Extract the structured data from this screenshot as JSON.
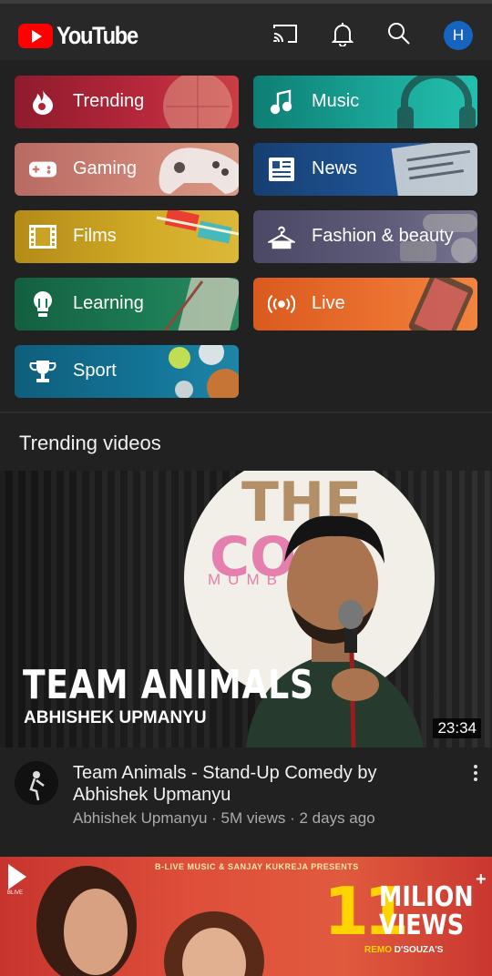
{
  "app": {
    "logo_text": "YouTube",
    "avatar_initial": "H"
  },
  "topbar": {
    "icons": [
      "cast-icon",
      "bell-icon",
      "search-icon"
    ]
  },
  "explore": {
    "chips": [
      {
        "label": "Trending",
        "icon": "flame-icon",
        "color": "#b3263a"
      },
      {
        "label": "Music",
        "icon": "music-note-icon",
        "color": "#16a597"
      },
      {
        "label": "Gaming",
        "icon": "gamepad-icon",
        "color": "#c7776d"
      },
      {
        "label": "News",
        "icon": "newspaper-icon",
        "color": "#1d4f8c"
      },
      {
        "label": "Films",
        "icon": "film-strip-icon",
        "color": "#c9a226"
      },
      {
        "label": "Fashion & beauty",
        "icon": "hanger-icon",
        "color": "#5c5a75"
      },
      {
        "label": "Learning",
        "icon": "lightbulb-icon",
        "color": "#1b7a52"
      },
      {
        "label": "Live",
        "icon": "live-broadcast-icon",
        "color": "#e8692a"
      },
      {
        "label": "Sport",
        "icon": "trophy-icon",
        "color": "#137496"
      }
    ]
  },
  "section": {
    "title": "Trending videos"
  },
  "videos": [
    {
      "thumb_title": "TEAM ANIMALS",
      "thumb_subtitle": "ABHISHEK UPMANYU",
      "sign_the": "THE",
      "sign_comedy": "CO",
      "sign_city": "MUMB",
      "duration": "23:34",
      "title": "Team Animals - Stand-Up Comedy by Abhishek Upmanyu",
      "meta": "Abhishek Upmanyu · 5M views · 2 days ago"
    },
    {
      "thumb_top": "B-LIVE MUSIC & SANJAY KUKREJA PRESENTS",
      "thumb_number": "11",
      "thumb_milion": "MILION",
      "thumb_views": "VIEWS",
      "thumb_plus": "+",
      "thumb_remo_a": "REMO",
      "thumb_remo_b": "D'SOUZA'S",
      "logo_text": "BLIVE"
    }
  ]
}
